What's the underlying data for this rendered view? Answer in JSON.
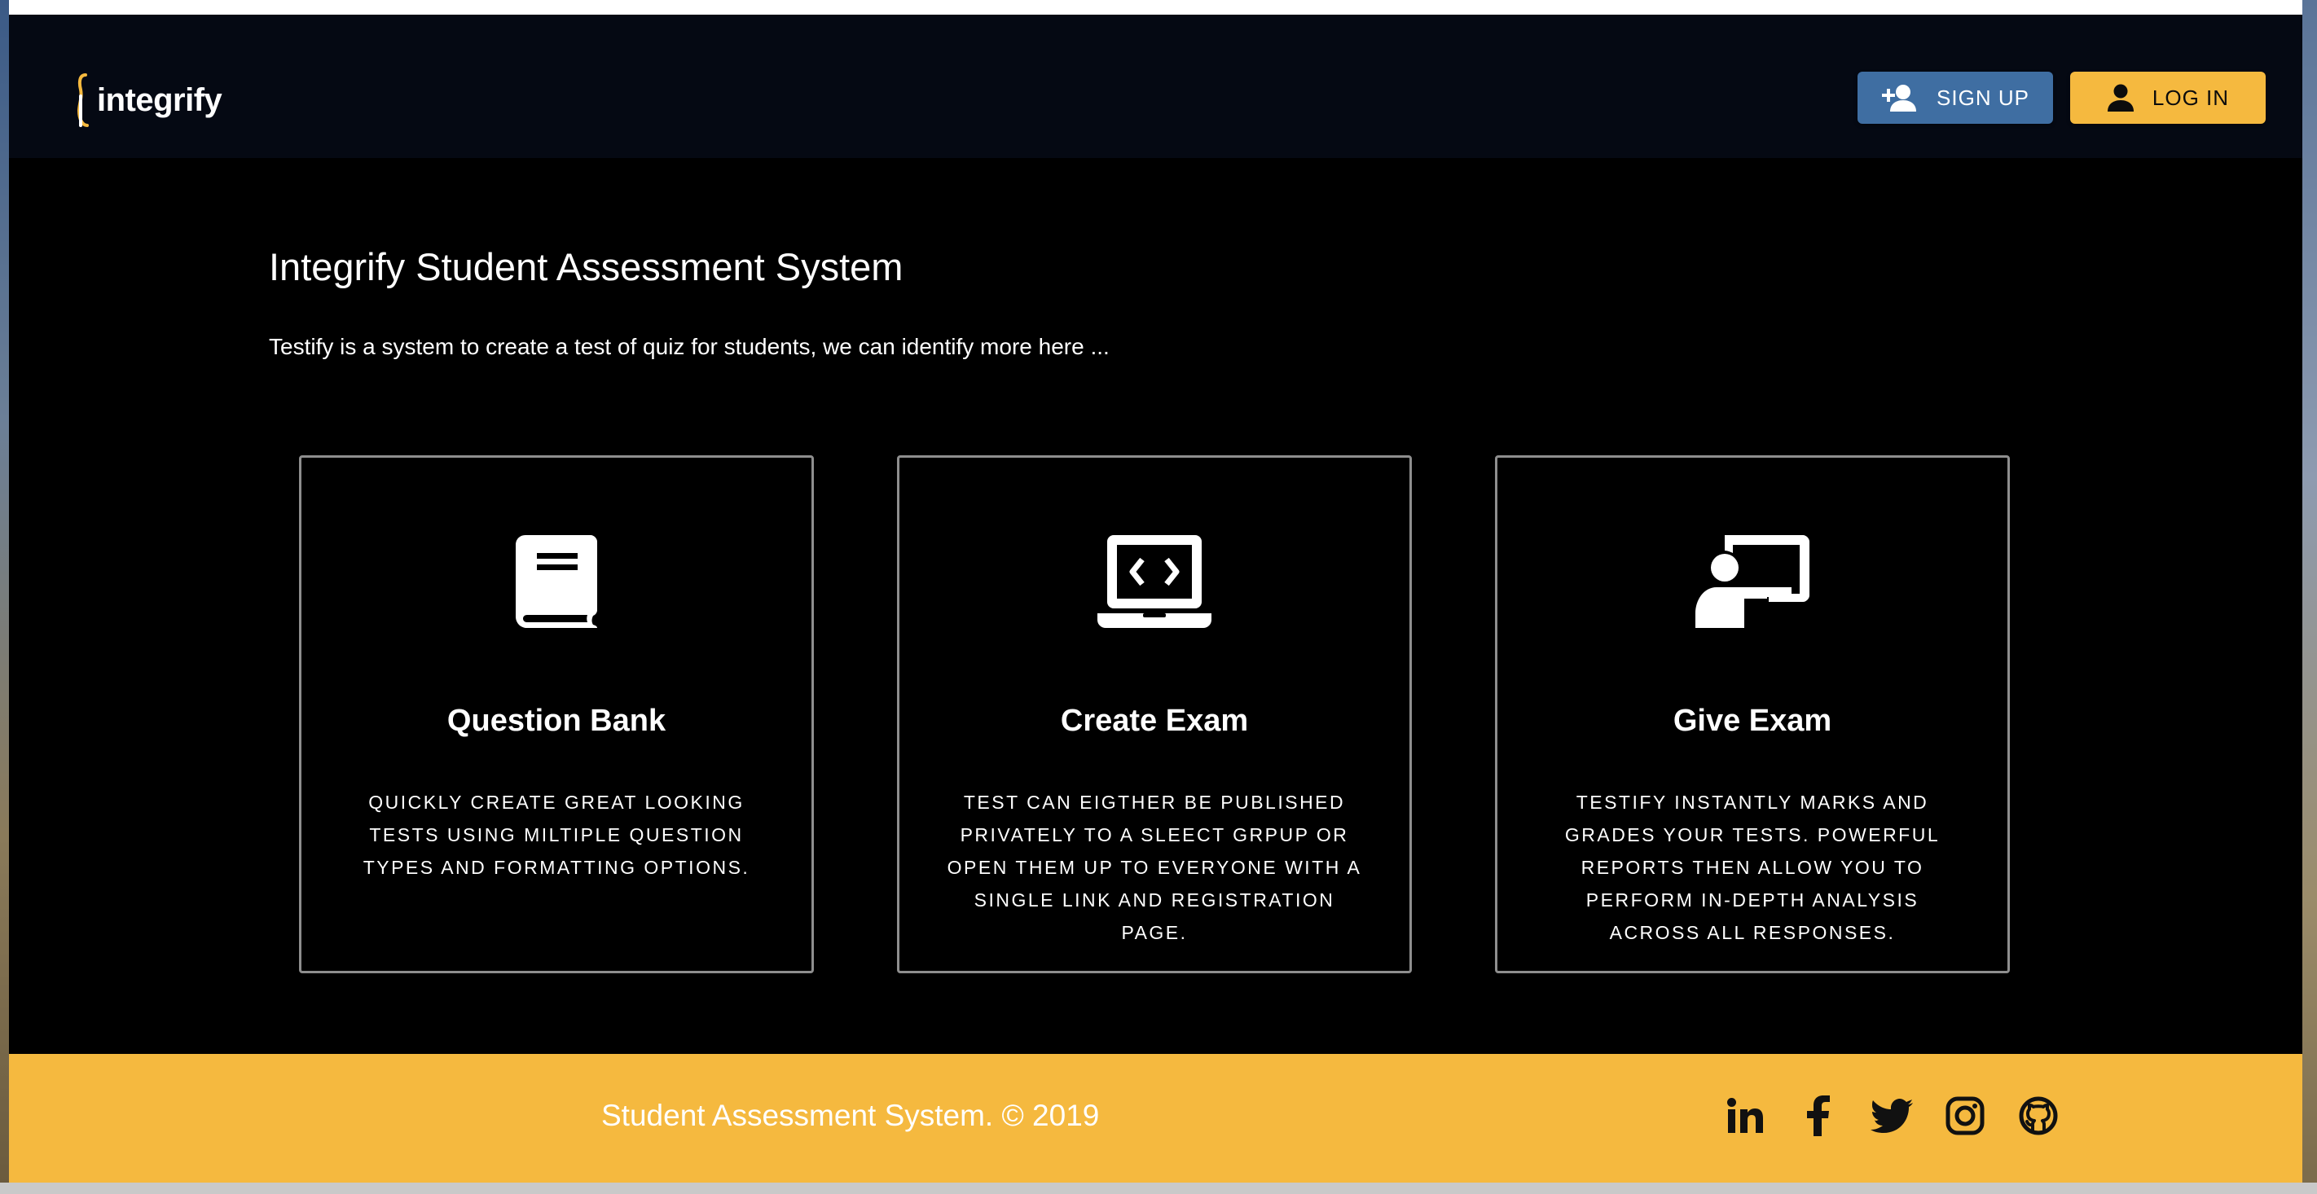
{
  "app": {
    "logo_text": "integrify"
  },
  "header": {
    "signup_label": "SIGN UP",
    "login_label": "LOG IN",
    "signup_icon": "person-add-icon",
    "login_icon": "person-icon"
  },
  "hero": {
    "title": "Integrify Student Assessment System",
    "description": "Testify is a system to create a test of quiz for students, we can identify more here ..."
  },
  "cards": [
    {
      "icon": "book-icon",
      "title": "Question Bank",
      "text": "QUICKLY CREATE GREAT LOOKING TESTS USING MILTIPLE QUESTION TYPES AND FORMATTING OPTIONS."
    },
    {
      "icon": "laptop-code-icon",
      "title": "Create Exam",
      "text": "TEST CAN EIGTHER BE PUBLISHED PRIVATELY TO A SLEECT GRPUP OR OPEN THEM UP TO EVERYONE WITH A SINGLE LINK AND REGISTRATION PAGE."
    },
    {
      "icon": "chalkboard-teacher-icon",
      "title": "Give Exam",
      "text": "TESTIFY INSTANTLY MARKS AND GRADES YOUR TESTS. POWERFUL REPORTS THEN ALLOW YOU TO PERFORM IN-DEPTH ANALYSIS ACROSS ALL RESPONSES."
    }
  ],
  "footer": {
    "copyright": "Student Assessment System. © 2019",
    "social_icons": [
      "linkedin-icon",
      "facebook-icon",
      "twitter-icon",
      "instagram-icon",
      "github-icon"
    ]
  },
  "colors": {
    "accent_yellow": "#f5b93f",
    "signup_blue": "#3f6ea2",
    "header_bg": "#050913",
    "page_bg": "#000000"
  }
}
